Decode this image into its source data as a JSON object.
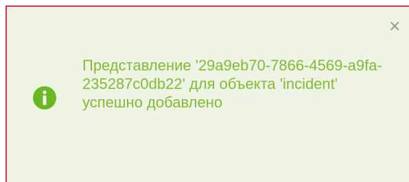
{
  "notification": {
    "type": "info",
    "message": "Представление '29a9eb70-7866-4569-a9fa-235287c0db22' для объекта 'incident' успешно добавлено",
    "close_label": "×",
    "icon": "info-circle-icon",
    "colors": {
      "background": "#eef3e4",
      "text": "#82bb36",
      "icon": "#6bb825",
      "border": "#e0303a"
    }
  }
}
